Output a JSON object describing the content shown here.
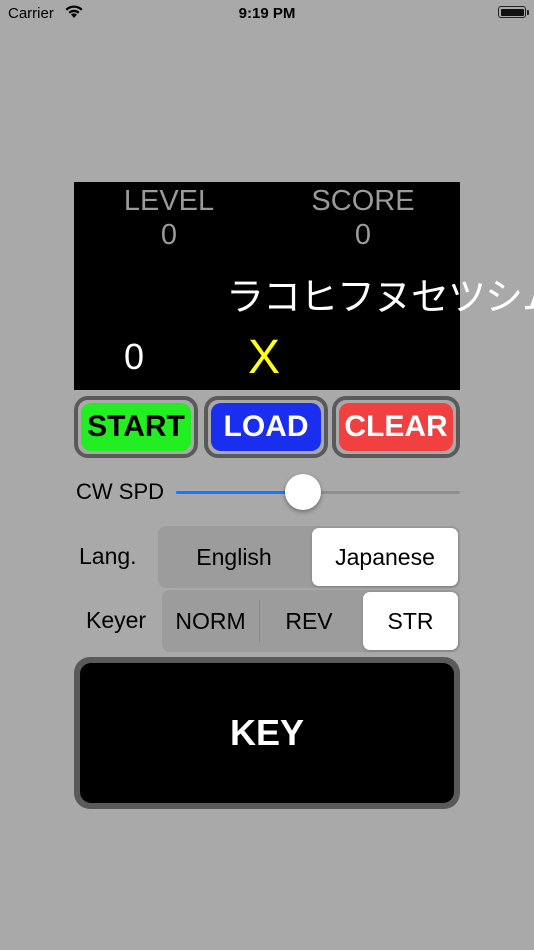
{
  "status_bar": {
    "carrier": "Carrier",
    "time": "9:19 PM"
  },
  "display": {
    "level_label": "LEVEL",
    "level_value": "0",
    "score_label": "SCORE",
    "score_value": "0",
    "characters": "ラコヒフヌセツシム",
    "count": "0",
    "mark": "X",
    "mark_color": "#ffff1a"
  },
  "buttons": {
    "start": "START",
    "load": "LOAD",
    "clear": "CLEAR",
    "start_color": "#22ee22",
    "load_color": "#1a2ef0",
    "clear_color": "#f04040"
  },
  "cw_speed": {
    "label": "CW SPD",
    "value_fraction": 0.44
  },
  "language": {
    "label": "Lang.",
    "options": [
      "English",
      "Japanese"
    ],
    "selected": "Japanese"
  },
  "keyer": {
    "label": "Keyer",
    "options": [
      "NORM",
      "REV",
      "STR"
    ],
    "selected": "STR"
  },
  "key_button": {
    "label": "KEY"
  }
}
